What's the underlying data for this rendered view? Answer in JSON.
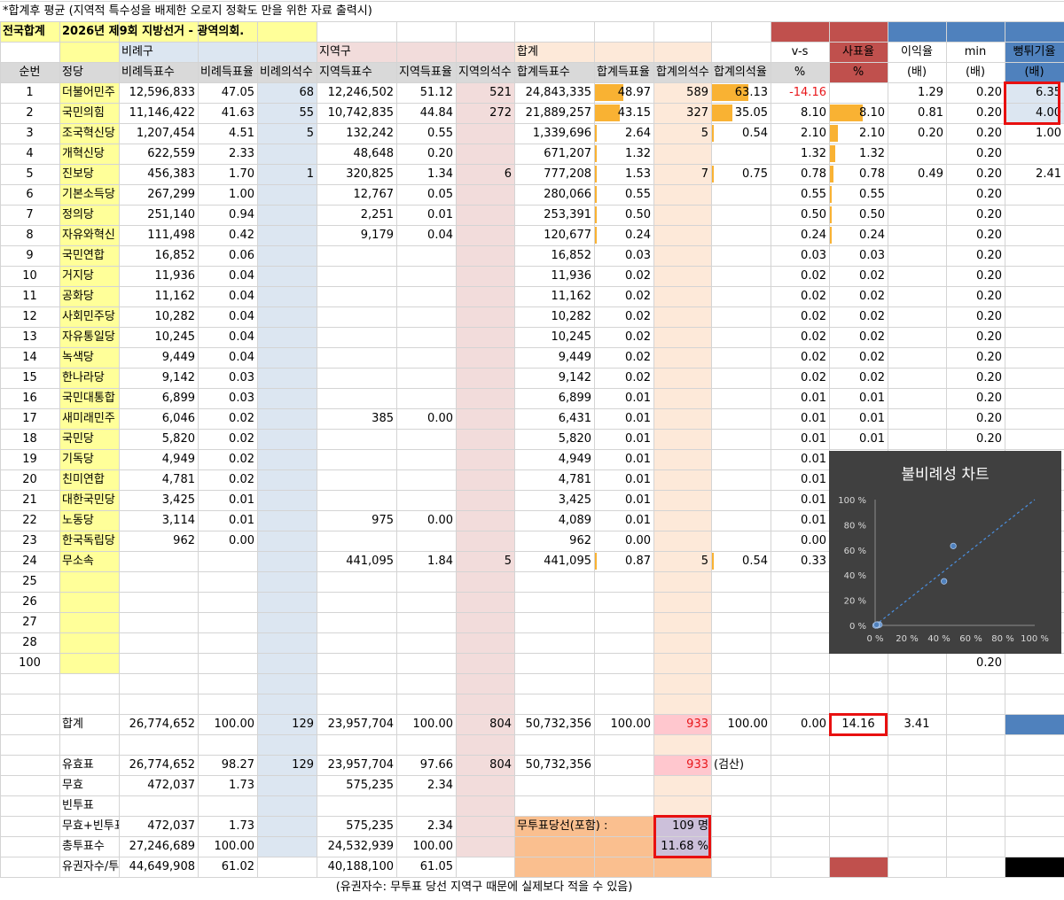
{
  "note": "*합계후 평균 (지역적 특수성을 배제한 오로지 정확도 만을 위한 자료 출력시)",
  "title_cell": "전국합계",
  "subtitle": "2026년 제9회 지방선거 - 광역의회.",
  "groups": {
    "pr": "비례구",
    "local": "지역구",
    "total": "합계"
  },
  "right_headers": {
    "vs": "v-s",
    "vs_unit": "%",
    "sapyo": "사표율",
    "sapyo_unit": "%",
    "ratio": "이익율",
    "ratio_unit": "(배)",
    "min": "min",
    "min_unit": "(배)",
    "jump": "뻥튀기율",
    "jump_unit": "(배)"
  },
  "columns": [
    "순번",
    "정당",
    "비례득표수",
    "비례득표율",
    "비례의석수",
    "지역득표수",
    "지역득표율",
    "지역의석수",
    "합계득표수",
    "합계득표율",
    "합계의석수",
    "합계의석율"
  ],
  "rows": [
    {
      "n": "1",
      "party": "더불어민주",
      "prv": "12,596,833",
      "prp": "47.05",
      "prs": "68",
      "lv": "12,246,502",
      "lp": "51.12",
      "ls": "521",
      "tv": "24,843,335",
      "tp": "48.97",
      "tpn": 48.97,
      "ts": "589",
      "tsp": "63.13",
      "tspn": 63.13,
      "vs": "-14.16",
      "sap": "",
      "sapn": 0,
      "ratio": "1.29",
      "min": "0.20",
      "jump": "6.35"
    },
    {
      "n": "2",
      "party": "국민의힘",
      "prv": "11,146,422",
      "prp": "41.63",
      "prs": "55",
      "lv": "10,742,835",
      "lp": "44.84",
      "ls": "272",
      "tv": "21,889,257",
      "tp": "43.15",
      "tpn": 43.15,
      "ts": "327",
      "tsp": "35.05",
      "tspn": 35.05,
      "vs": "8.10",
      "sap": "8.10",
      "sapn": 8.1,
      "ratio": "0.81",
      "min": "0.20",
      "jump": "4.00"
    },
    {
      "n": "3",
      "party": "조국혁신당",
      "prv": "1,207,454",
      "prp": "4.51",
      "prs": "5",
      "lv": "132,242",
      "lp": "0.55",
      "ls": "",
      "tv": "1,339,696",
      "tp": "2.64",
      "tpn": 2.64,
      "ts": "5",
      "tsp": "0.54",
      "tspn": 0.54,
      "vs": "2.10",
      "sap": "2.10",
      "sapn": 2.1,
      "ratio": "0.20",
      "min": "0.20",
      "jump": "1.00"
    },
    {
      "n": "4",
      "party": "개혁신당",
      "prv": "622,559",
      "prp": "2.33",
      "prs": "",
      "lv": "48,648",
      "lp": "0.20",
      "ls": "",
      "tv": "671,207",
      "tp": "1.32",
      "tpn": 1.32,
      "ts": "",
      "tsp": "",
      "tspn": 0,
      "vs": "1.32",
      "sap": "1.32",
      "sapn": 1.32,
      "ratio": "",
      "min": "0.20",
      "jump": ""
    },
    {
      "n": "5",
      "party": "진보당",
      "prv": "456,383",
      "prp": "1.70",
      "prs": "1",
      "lv": "320,825",
      "lp": "1.34",
      "ls": "6",
      "tv": "777,208",
      "tp": "1.53",
      "tpn": 1.53,
      "ts": "7",
      "tsp": "0.75",
      "tspn": 0.75,
      "vs": "0.78",
      "sap": "0.78",
      "sapn": 0.78,
      "ratio": "0.49",
      "min": "0.20",
      "jump": "2.41"
    },
    {
      "n": "6",
      "party": "기본소득당",
      "prv": "267,299",
      "prp": "1.00",
      "prs": "",
      "lv": "12,767",
      "lp": "0.05",
      "ls": "",
      "tv": "280,066",
      "tp": "0.55",
      "tpn": 0.55,
      "ts": "",
      "tsp": "",
      "tspn": 0,
      "vs": "0.55",
      "sap": "0.55",
      "sapn": 0.55,
      "ratio": "",
      "min": "0.20",
      "jump": ""
    },
    {
      "n": "7",
      "party": "정의당",
      "prv": "251,140",
      "prp": "0.94",
      "prs": "",
      "lv": "2,251",
      "lp": "0.01",
      "ls": "",
      "tv": "253,391",
      "tp": "0.50",
      "tpn": 0.5,
      "ts": "",
      "tsp": "",
      "tspn": 0,
      "vs": "0.50",
      "sap": "0.50",
      "sapn": 0.5,
      "ratio": "",
      "min": "0.20",
      "jump": ""
    },
    {
      "n": "8",
      "party": "자유와혁신",
      "prv": "111,498",
      "prp": "0.42",
      "prs": "",
      "lv": "9,179",
      "lp": "0.04",
      "ls": "",
      "tv": "120,677",
      "tp": "0.24",
      "tpn": 0.24,
      "ts": "",
      "tsp": "",
      "tspn": 0,
      "vs": "0.24",
      "sap": "0.24",
      "sapn": 0.24,
      "ratio": "",
      "min": "0.20",
      "jump": ""
    },
    {
      "n": "9",
      "party": "국민연합",
      "prv": "16,852",
      "prp": "0.06",
      "prs": "",
      "lv": "",
      "lp": "",
      "ls": "",
      "tv": "16,852",
      "tp": "0.03",
      "tpn": 0.03,
      "ts": "",
      "tsp": "",
      "tspn": 0,
      "vs": "0.03",
      "sap": "0.03",
      "sapn": 0.03,
      "ratio": "",
      "min": "0.20",
      "jump": ""
    },
    {
      "n": "10",
      "party": "거지당",
      "prv": "11,936",
      "prp": "0.04",
      "prs": "",
      "lv": "",
      "lp": "",
      "ls": "",
      "tv": "11,936",
      "tp": "0.02",
      "tpn": 0.02,
      "ts": "",
      "tsp": "",
      "tspn": 0,
      "vs": "0.02",
      "sap": "0.02",
      "sapn": 0.02,
      "ratio": "",
      "min": "0.20",
      "jump": ""
    },
    {
      "n": "11",
      "party": "공화당",
      "prv": "11,162",
      "prp": "0.04",
      "prs": "",
      "lv": "",
      "lp": "",
      "ls": "",
      "tv": "11,162",
      "tp": "0.02",
      "tpn": 0.02,
      "ts": "",
      "tsp": "",
      "tspn": 0,
      "vs": "0.02",
      "sap": "0.02",
      "sapn": 0.02,
      "ratio": "",
      "min": "0.20",
      "jump": ""
    },
    {
      "n": "12",
      "party": "사회민주당",
      "prv": "10,282",
      "prp": "0.04",
      "prs": "",
      "lv": "",
      "lp": "",
      "ls": "",
      "tv": "10,282",
      "tp": "0.02",
      "tpn": 0.02,
      "ts": "",
      "tsp": "",
      "tspn": 0,
      "vs": "0.02",
      "sap": "0.02",
      "sapn": 0.02,
      "ratio": "",
      "min": "0.20",
      "jump": ""
    },
    {
      "n": "13",
      "party": "자유통일당",
      "prv": "10,245",
      "prp": "0.04",
      "prs": "",
      "lv": "",
      "lp": "",
      "ls": "",
      "tv": "10,245",
      "tp": "0.02",
      "tpn": 0.02,
      "ts": "",
      "tsp": "",
      "tspn": 0,
      "vs": "0.02",
      "sap": "0.02",
      "sapn": 0.02,
      "ratio": "",
      "min": "0.20",
      "jump": ""
    },
    {
      "n": "14",
      "party": "녹색당",
      "prv": "9,449",
      "prp": "0.04",
      "prs": "",
      "lv": "",
      "lp": "",
      "ls": "",
      "tv": "9,449",
      "tp": "0.02",
      "tpn": 0.02,
      "ts": "",
      "tsp": "",
      "tspn": 0,
      "vs": "0.02",
      "sap": "0.02",
      "sapn": 0.02,
      "ratio": "",
      "min": "0.20",
      "jump": ""
    },
    {
      "n": "15",
      "party": "한나라당",
      "prv": "9,142",
      "prp": "0.03",
      "prs": "",
      "lv": "",
      "lp": "",
      "ls": "",
      "tv": "9,142",
      "tp": "0.02",
      "tpn": 0.02,
      "ts": "",
      "tsp": "",
      "tspn": 0,
      "vs": "0.02",
      "sap": "0.02",
      "sapn": 0.02,
      "ratio": "",
      "min": "0.20",
      "jump": ""
    },
    {
      "n": "16",
      "party": "국민대통합",
      "prv": "6,899",
      "prp": "0.03",
      "prs": "",
      "lv": "",
      "lp": "",
      "ls": "",
      "tv": "6,899",
      "tp": "0.01",
      "tpn": 0.01,
      "ts": "",
      "tsp": "",
      "tspn": 0,
      "vs": "0.01",
      "sap": "0.01",
      "sapn": 0.01,
      "ratio": "",
      "min": "0.20",
      "jump": ""
    },
    {
      "n": "17",
      "party": "새미래민주",
      "prv": "6,046",
      "prp": "0.02",
      "prs": "",
      "lv": "385",
      "lp": "0.00",
      "ls": "",
      "tv": "6,431",
      "tp": "0.01",
      "tpn": 0.01,
      "ts": "",
      "tsp": "",
      "tspn": 0,
      "vs": "0.01",
      "sap": "0.01",
      "sapn": 0.01,
      "ratio": "",
      "min": "0.20",
      "jump": ""
    },
    {
      "n": "18",
      "party": "국민당",
      "prv": "5,820",
      "prp": "0.02",
      "prs": "",
      "lv": "",
      "lp": "",
      "ls": "",
      "tv": "5,820",
      "tp": "0.01",
      "tpn": 0.01,
      "ts": "",
      "tsp": "",
      "tspn": 0,
      "vs": "0.01",
      "sap": "0.01",
      "sapn": 0.01,
      "ratio": "",
      "min": "0.20",
      "jump": ""
    },
    {
      "n": "19",
      "party": "기독당",
      "prv": "4,949",
      "prp": "0.02",
      "prs": "",
      "lv": "",
      "lp": "",
      "ls": "",
      "tv": "4,949",
      "tp": "0.01",
      "tpn": 0.01,
      "ts": "",
      "tsp": "",
      "tspn": 0,
      "vs": "0.01",
      "sap": "",
      "sapn": 0,
      "ratio": "",
      "min": "",
      "jump": ""
    },
    {
      "n": "20",
      "party": "친미연합",
      "prv": "4,781",
      "prp": "0.02",
      "prs": "",
      "lv": "",
      "lp": "",
      "ls": "",
      "tv": "4,781",
      "tp": "0.01",
      "tpn": 0.01,
      "ts": "",
      "tsp": "",
      "tspn": 0,
      "vs": "0.01",
      "sap": "",
      "sapn": 0,
      "ratio": "",
      "min": "",
      "jump": ""
    },
    {
      "n": "21",
      "party": "대한국민당",
      "prv": "3,425",
      "prp": "0.01",
      "prs": "",
      "lv": "",
      "lp": "",
      "ls": "",
      "tv": "3,425",
      "tp": "0.01",
      "tpn": 0.01,
      "ts": "",
      "tsp": "",
      "tspn": 0,
      "vs": "0.01",
      "sap": "",
      "sapn": 0,
      "ratio": "",
      "min": "",
      "jump": ""
    },
    {
      "n": "22",
      "party": "노동당",
      "prv": "3,114",
      "prp": "0.01",
      "prs": "",
      "lv": "975",
      "lp": "0.00",
      "ls": "",
      "tv": "4,089",
      "tp": "0.01",
      "tpn": 0.01,
      "ts": "",
      "tsp": "",
      "tspn": 0,
      "vs": "0.01",
      "sap": "",
      "sapn": 0,
      "ratio": "",
      "min": "",
      "jump": ""
    },
    {
      "n": "23",
      "party": "한국독립당",
      "prv": "962",
      "prp": "0.00",
      "prs": "",
      "lv": "",
      "lp": "",
      "ls": "",
      "tv": "962",
      "tp": "0.00",
      "tpn": 0.0,
      "ts": "",
      "tsp": "",
      "tspn": 0,
      "vs": "0.00",
      "sap": "",
      "sapn": 0,
      "ratio": "",
      "min": "",
      "jump": ""
    },
    {
      "n": "24",
      "party": "무소속",
      "prv": "",
      "prp": "",
      "prs": "",
      "lv": "441,095",
      "lp": "1.84",
      "ls": "5",
      "tv": "441,095",
      "tp": "0.87",
      "tpn": 0.87,
      "ts": "5",
      "tsp": "0.54",
      "tspn": 0.54,
      "vs": "0.33",
      "sap": "",
      "sapn": 0,
      "ratio": "",
      "min": "",
      "jump": ""
    },
    {
      "n": "25",
      "party": "",
      "prv": "",
      "prp": "",
      "prs": "",
      "lv": "",
      "lp": "",
      "ls": "",
      "tv": "",
      "tp": "",
      "tpn": 0,
      "ts": "",
      "tsp": "",
      "tspn": 0,
      "vs": "",
      "sap": "",
      "sapn": 0,
      "ratio": "",
      "min": "",
      "jump": ""
    },
    {
      "n": "26",
      "party": "",
      "prv": "",
      "prp": "",
      "prs": "",
      "lv": "",
      "lp": "",
      "ls": "",
      "tv": "",
      "tp": "",
      "tpn": 0,
      "ts": "",
      "tsp": "",
      "tspn": 0,
      "vs": "",
      "sap": "",
      "sapn": 0,
      "ratio": "",
      "min": "",
      "jump": ""
    },
    {
      "n": "27",
      "party": "",
      "prv": "",
      "prp": "",
      "prs": "",
      "lv": "",
      "lp": "",
      "ls": "",
      "tv": "",
      "tp": "",
      "tpn": 0,
      "ts": "",
      "tsp": "",
      "tspn": 0,
      "vs": "",
      "sap": "",
      "sapn": 0,
      "ratio": "",
      "min": "",
      "jump": ""
    },
    {
      "n": "28",
      "party": "",
      "prv": "",
      "prp": "",
      "prs": "",
      "lv": "",
      "lp": "",
      "ls": "",
      "tv": "",
      "tp": "",
      "tpn": 0,
      "ts": "",
      "tsp": "",
      "tspn": 0,
      "vs": "",
      "sap": "",
      "sapn": 0,
      "ratio": "",
      "min": "",
      "jump": ""
    },
    {
      "n": "100",
      "party": "",
      "prv": "",
      "prp": "",
      "prs": "",
      "lv": "",
      "lp": "",
      "ls": "",
      "tv": "",
      "tp": "",
      "tpn": 0,
      "ts": "",
      "tsp": "",
      "tspn": 0,
      "vs": "",
      "sap": "",
      "sapn": 0,
      "ratio": "",
      "min": "0.20",
      "jump": ""
    }
  ],
  "total_row": {
    "label": "합계",
    "prv": "26,774,652",
    "prp": "100.00",
    "prs": "129",
    "lv": "23,957,704",
    "lp": "100.00",
    "ls": "804",
    "tv": "50,732,356",
    "tp": "100.00",
    "ts": "933",
    "tsp": "100.00",
    "vs": "0.00",
    "sap": "14.16",
    "ratio": "3.41"
  },
  "summary_rows": [
    {
      "label": "유효표",
      "prv": "26,774,652",
      "prp": "98.27",
      "prs": "129",
      "lv": "23,957,704",
      "lp": "97.66",
      "ls": "804",
      "tv": "50,732,356",
      "ts": "933",
      "extra": "(검산)"
    },
    {
      "label": "무효",
      "prv": "472,037",
      "prp": "1.73",
      "prs": "",
      "lv": "575,235",
      "lp": "2.34",
      "ls": "",
      "tv": "",
      "ts": "",
      "extra": ""
    },
    {
      "label": "빈투표",
      "prv": "",
      "prp": "",
      "prs": "",
      "lv": "",
      "lp": "",
      "ls": "",
      "tv": "",
      "ts": "",
      "extra": ""
    },
    {
      "label": "무효+빈투표",
      "prv": "472,037",
      "prp": "1.73",
      "prs": "",
      "lv": "575,235",
      "lp": "2.34",
      "ls": "",
      "tv": "",
      "ts": "",
      "extra": ""
    },
    {
      "label": "총투표수",
      "prv": "27,246,689",
      "prp": "100.00",
      "prs": "",
      "lv": "24,532,939",
      "lp": "100.00",
      "ls": "",
      "tv": "",
      "ts": "",
      "extra": ""
    },
    {
      "label": "유권자수/투표율",
      "prv": "44,649,908",
      "prp": "61.02",
      "prs": "",
      "lv": "40,188,100",
      "lp": "61.05",
      "ls": "",
      "tv": "",
      "ts": "",
      "extra": ""
    }
  ],
  "uncontested": {
    "label": "무투표당선(포함) :",
    "count": "109 명",
    "pct": "11.68 %"
  },
  "footer_note": "(유권자수: 무투표 당선 지역구 때문에 실제보다 적을 수 있음)",
  "colors": {
    "yellow": "#ffff99",
    "pr_bg": "#dce6f1",
    "local_bg": "#f2dcdb",
    "total_bg": "#fde9d9",
    "seat_bg": "#e4dfec",
    "bar": "#f9b233",
    "red_hdr": "#c0504d",
    "blue_hdr": "#4f81bd",
    "peach": "#fabf8f",
    "pink": "#ffc7ce",
    "lavender": "#ccc0da",
    "chart_bg": "#404040"
  },
  "chart_data": {
    "type": "scatter",
    "title": "불비례성 차트",
    "xlabel": "",
    "ylabel": "",
    "xlim": [
      0,
      100
    ],
    "ylim": [
      0,
      100
    ],
    "x_ticks": [
      "0 %",
      "20 %",
      "40 %",
      "60 %",
      "80 %",
      "100 %"
    ],
    "y_ticks": [
      "0 %",
      "20 %",
      "40 %",
      "60 %",
      "80 %",
      "100 %"
    ],
    "trendline": {
      "style": "dashed",
      "from": [
        0,
        0
      ],
      "to": [
        100,
        100
      ]
    },
    "points": [
      {
        "x": 48.97,
        "y": 63.13
      },
      {
        "x": 43.15,
        "y": 35.05
      },
      {
        "x": 2.64,
        "y": 0.54
      },
      {
        "x": 1.32,
        "y": 0
      },
      {
        "x": 1.53,
        "y": 0.75
      },
      {
        "x": 0.55,
        "y": 0
      },
      {
        "x": 0.5,
        "y": 0
      },
      {
        "x": 0.24,
        "y": 0
      },
      {
        "x": 0.87,
        "y": 0.54
      }
    ],
    "grid": false,
    "legend": "none"
  }
}
